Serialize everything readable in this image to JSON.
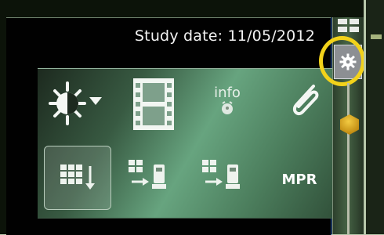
{
  "viewer": {
    "study_date": "Study date: 11/05/2012"
  },
  "toolbar": {
    "info_label": "info",
    "mpr_label": "MPR",
    "icons": [
      "brightness-contrast-icon",
      "film-icon",
      "info-icon",
      "paperclip-icon",
      "layout-grid-icon",
      "send-series-icon",
      "send-series-alt-icon"
    ]
  },
  "sidebar": {
    "active_button": "gear-icon",
    "highlight_color": "#f2d21a"
  },
  "colors": {
    "panel_start": "#1d2a1f",
    "panel_mid": "#67a47f",
    "panel_end": "#2f4d37",
    "accent_gold": "#c38d13"
  }
}
